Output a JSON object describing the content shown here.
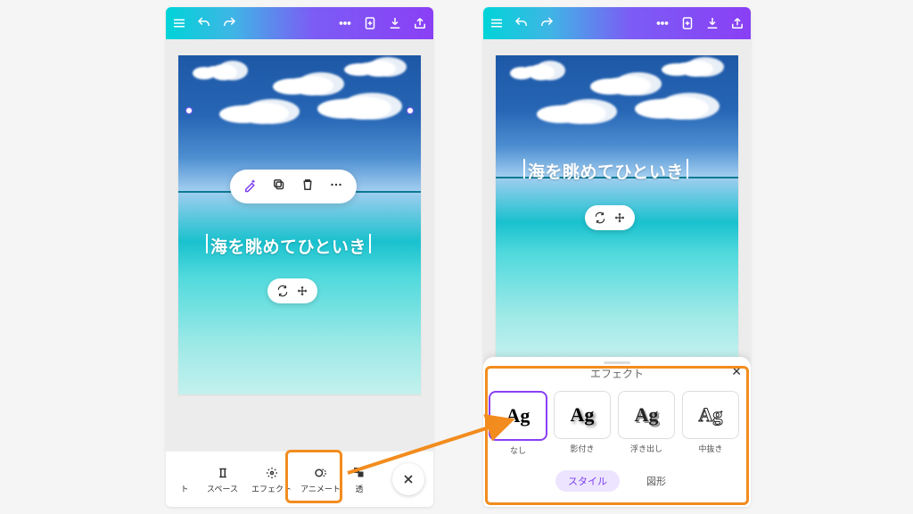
{
  "canvas_text": "海を眺めてひといき",
  "bottom_items": [
    {
      "label": "ト"
    },
    {
      "label": "スペース"
    },
    {
      "label": "エフェクト"
    },
    {
      "label": "アニメート"
    },
    {
      "label": "透"
    }
  ],
  "sheet": {
    "title": "エフェクト",
    "tabs": {
      "style": "スタイル",
      "shape": "図形"
    },
    "effects": [
      {
        "key": "none",
        "label": "なし",
        "sample": "Ag"
      },
      {
        "key": "shadow",
        "label": "影付き",
        "sample": "Ag"
      },
      {
        "key": "emboss",
        "label": "浮き出し",
        "sample": "Ag"
      },
      {
        "key": "outline",
        "label": "中抜き",
        "sample": "Ag"
      }
    ]
  }
}
